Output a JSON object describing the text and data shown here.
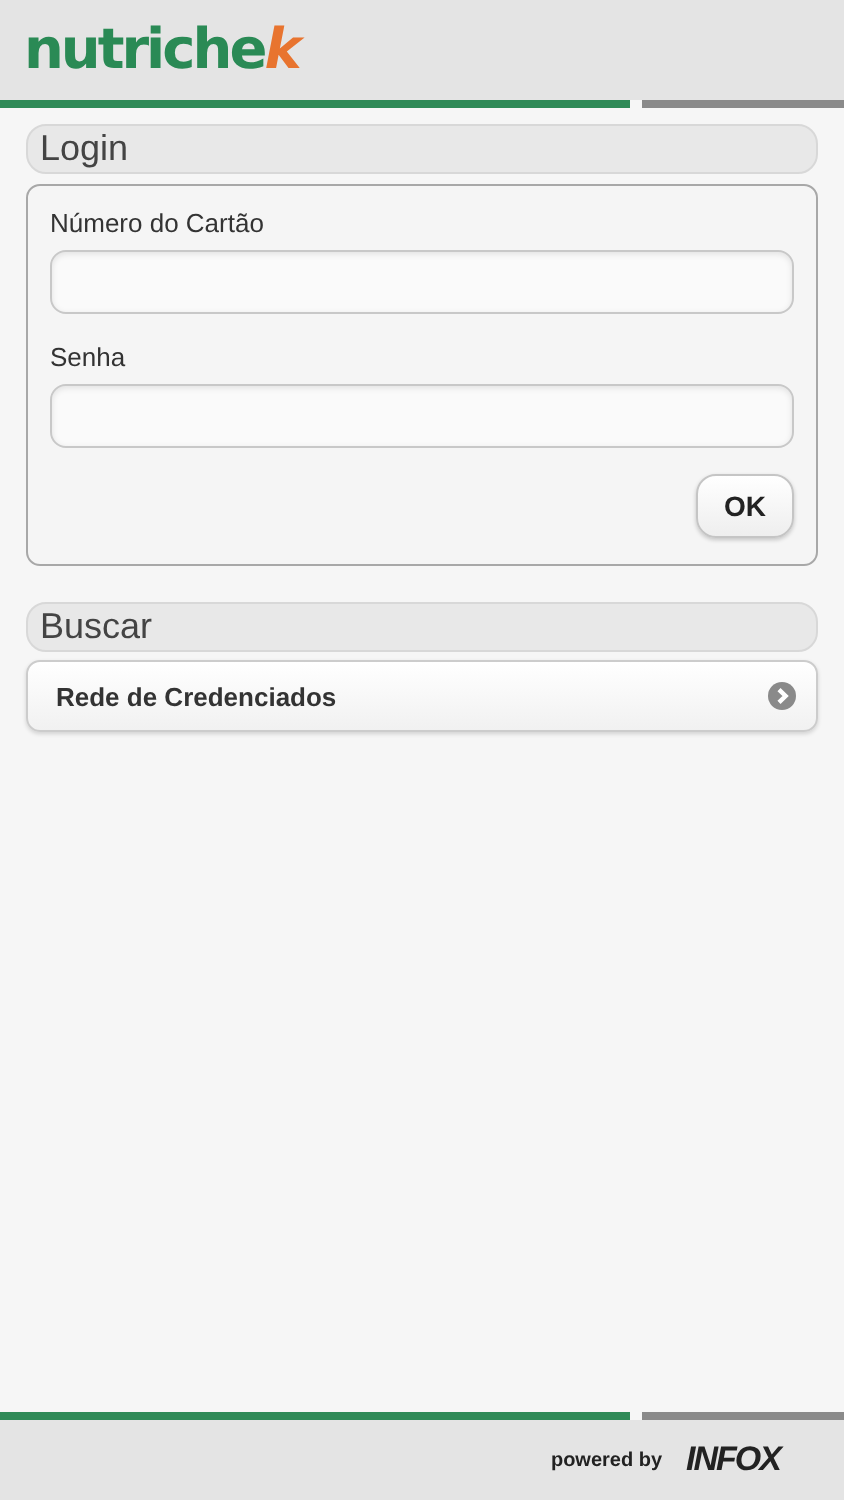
{
  "header": {
    "logo": {
      "text": "nutriche",
      "accent": "k"
    }
  },
  "login": {
    "title": "Login",
    "fields": [
      {
        "label": "Número do Cartão"
      },
      {
        "label": "Senha"
      }
    ],
    "button": "OK"
  },
  "search": {
    "title": "Buscar",
    "items": [
      {
        "label": "Rede de Credenciados"
      }
    ]
  },
  "footer": {
    "powered_by": "powered by",
    "brand": "INFOX"
  }
}
